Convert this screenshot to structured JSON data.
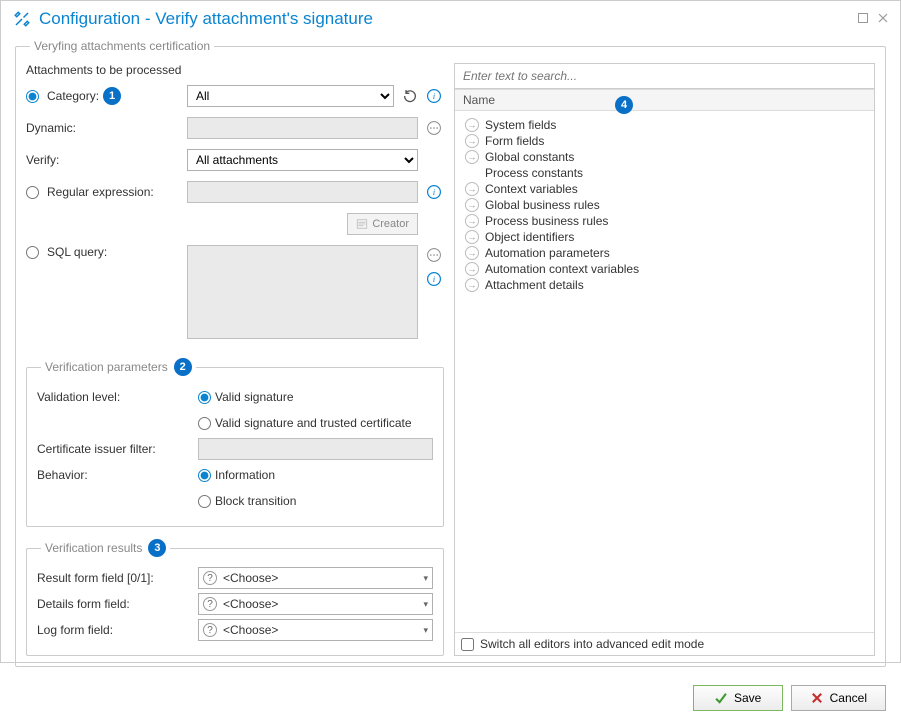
{
  "window": {
    "title": "Configuration - Verify attachment's signature"
  },
  "fieldset_main_legend": "Veryfing attachments certification",
  "attachments_section": {
    "header": "Attachments to be processed",
    "category_label": "Category:",
    "category_value": "All",
    "dynamic_label": "Dynamic:",
    "verify_label": "Verify:",
    "verify_value": "All attachments",
    "regex_label": "Regular expression:",
    "creator_label": "Creator",
    "sql_label": "SQL query:"
  },
  "verification_params": {
    "legend": "Verification parameters",
    "validation_label": "Validation level:",
    "valid_signature": "Valid signature",
    "valid_trusted": "Valid signature and trusted certificate",
    "cert_filter_label": "Certificate issuer filter:",
    "behavior_label": "Behavior:",
    "information": "Information",
    "block": "Block transition"
  },
  "verification_results": {
    "legend": "Verification results",
    "result_field_label": "Result form field [0/1]:",
    "details_field_label": "Details form field:",
    "log_field_label": "Log form field:",
    "choose": "<Choose>"
  },
  "tree_panel": {
    "search_placeholder": "Enter text to search...",
    "header": "Name",
    "items": [
      "System fields",
      "Form fields",
      "Global constants",
      "Process constants",
      "Context variables",
      "Global business rules",
      "Process business rules",
      "Object identifiers",
      "Automation parameters",
      "Automation context variables",
      "Attachment details"
    ],
    "advanced_mode": "Switch all editors into advanced edit mode"
  },
  "buttons": {
    "save": "Save",
    "cancel": "Cancel"
  },
  "badges": {
    "b1": "1",
    "b2": "2",
    "b3": "3",
    "b4": "4"
  }
}
